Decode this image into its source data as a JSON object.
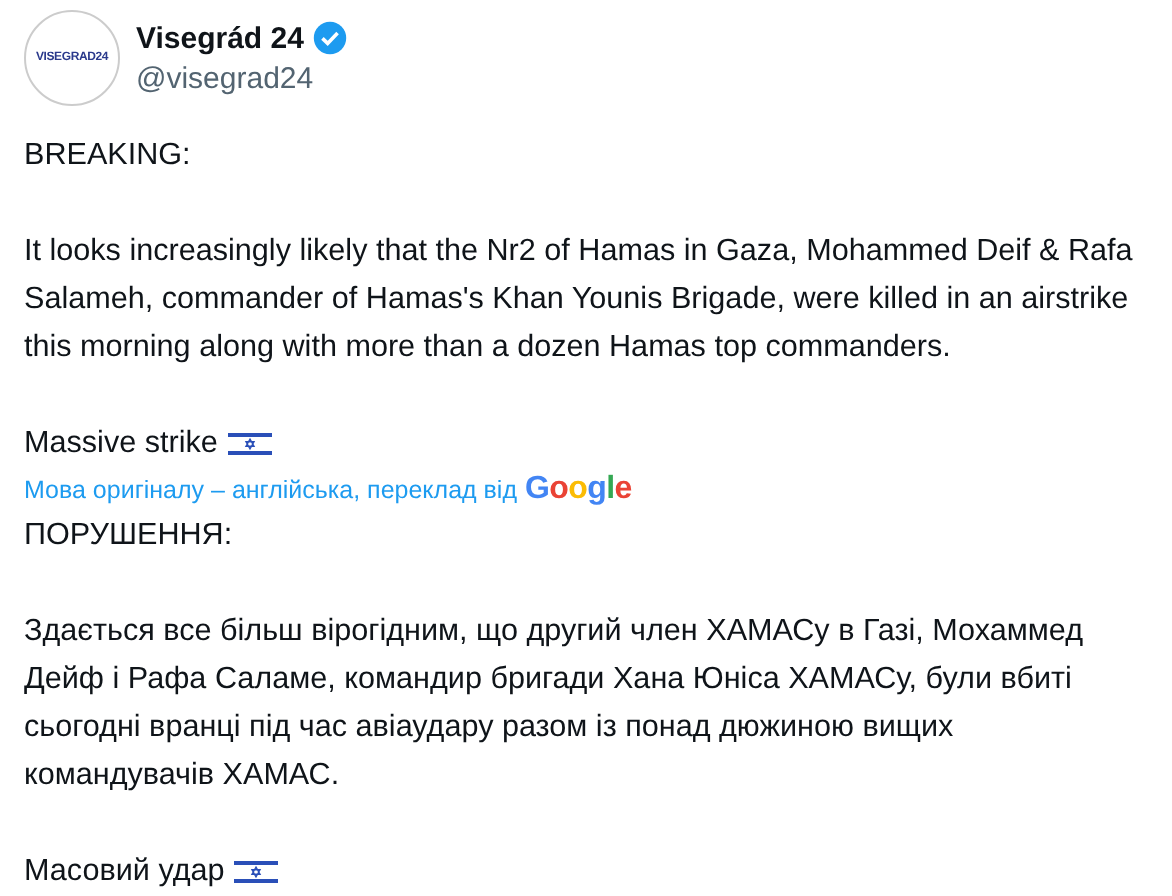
{
  "author": {
    "name": "Visegrád 24",
    "handle": "@visegrad24",
    "avatar_text": "VISEGRAD24",
    "verified": true
  },
  "original": {
    "heading": "BREAKING:",
    "body": "It looks increasingly likely that the Nr2 of Hamas in Gaza, Mohammed Deif & Rafa Salameh, commander of Hamas's Khan Younis Brigade, were killed in an airstrike this morning along with more than a dozen Hamas top commanders.",
    "closing": "Massive strike"
  },
  "translation_note": {
    "text": "Мова оригіналу – англійська, переклад від",
    "provider": "Google"
  },
  "translated": {
    "heading": "ПОРУШЕННЯ:",
    "body": "Здається все більш вірогідним, що другий член ХАМАСу в Газі, Мохаммед Дейф і Рафа Саламе, командир бригади Хана Юніса ХАМАСу, були вбиті сьогодні вранці під час авіаудару разом із понад дюжиною вищих командувачів ХАМАС.",
    "closing": "Масовий удар"
  }
}
